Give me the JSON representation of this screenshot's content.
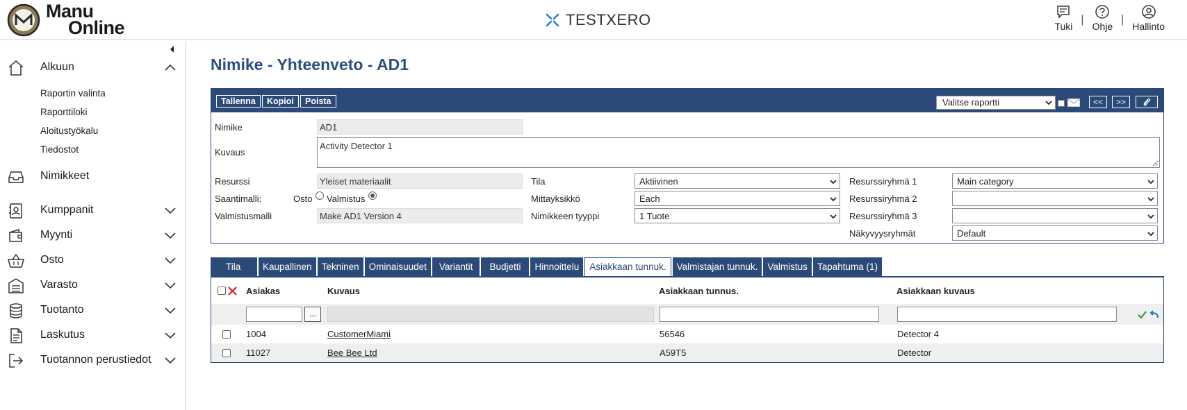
{
  "header": {
    "logo_line1": "Manu",
    "logo_line2": "Online",
    "brand": "TESTXERO",
    "actions": [
      {
        "label": "Tuki",
        "icon": "chat-icon"
      },
      {
        "label": "Ohje",
        "icon": "help-icon"
      },
      {
        "label": "Hallinto",
        "icon": "user-icon"
      }
    ],
    "separator": "|"
  },
  "sidebar": {
    "items": [
      {
        "label": "Alkuun",
        "icon": "home-icon",
        "expanded": true
      },
      {
        "label": "Nimikkeet",
        "icon": "inbox-icon"
      },
      {
        "label": "Kumppanit",
        "icon": "contacts-icon"
      },
      {
        "label": "Myynti",
        "icon": "wallet-icon"
      },
      {
        "label": "Osto",
        "icon": "basket-icon"
      },
      {
        "label": "Varasto",
        "icon": "warehouse-icon"
      },
      {
        "label": "Tuotanto",
        "icon": "database-icon"
      },
      {
        "label": "Laskutus",
        "icon": "invoice-icon"
      },
      {
        "label": "Tuotannon perustiedot",
        "icon": "exit-icon"
      }
    ],
    "sub_items": [
      "Raportin valinta",
      "Raporttiloki",
      "Aloitustyökalu",
      "Tiedostot"
    ]
  },
  "page": {
    "title": "Nimike - Yhteenveto - AD1"
  },
  "toolbar": {
    "buttons": [
      "Tallenna",
      "Kopioi",
      "Poista"
    ],
    "report_select": "Valitse raportti",
    "prev": "<<",
    "next": ">>"
  },
  "form": {
    "nimike_label": "Nimike",
    "nimike_value": "AD1",
    "kuvaus_label": "Kuvaus",
    "kuvaus_value": "Activity Detector 1",
    "resurssi_label": "Resurssi",
    "resurssi_value": "Yleiset materiaalit",
    "saantimalli_label": "Saantimalli:",
    "osto_label": "Osto",
    "valmistus_label": "Valmistus",
    "valmistusmalli_label": "Valmistusmalli",
    "valmistusmalli_value": "Make AD1 Version 4",
    "tila_label": "Tila",
    "tila_value": "Aktiivinen",
    "mittayksikko_label": "Mittayksikkö",
    "mittayksikko_value": "Each",
    "tyyppi_label": "Nimikkeen tyyppi",
    "tyyppi_value": "1 Tuote",
    "rr1_label": "Resurssiryhmä 1",
    "rr1_value": "Main category",
    "rr2_label": "Resurssiryhmä 2",
    "rr2_value": "",
    "rr3_label": "Resurssiryhmä 3",
    "rr3_value": "",
    "nakyvyys_label": "Näkyvyysryhmät",
    "nakyvyys_value": "Default"
  },
  "tabs": [
    {
      "label": "Tila"
    },
    {
      "label": "Kaupallinen"
    },
    {
      "label": "Tekninen"
    },
    {
      "label": "Ominaisuudet"
    },
    {
      "label": "Variantit"
    },
    {
      "label": "Budjetti"
    },
    {
      "label": "Hinnoittelu"
    },
    {
      "label": "Asiakkaan tunnuk.",
      "active": true
    },
    {
      "label": "Valmistajan tunnuk."
    },
    {
      "label": "Valmistus"
    },
    {
      "label": "Tapahtuma (1)"
    }
  ],
  "grid": {
    "columns": [
      "Asiakas",
      "Kuvaus",
      "Asiakkaan tunnus.",
      "Asiakkaan kuvaus"
    ],
    "dots": "...",
    "rows": [
      {
        "asiakas": "1004",
        "kuvaus": "CustomerMiami",
        "tunnus": "56546",
        "asiakkaan_kuvaus": "Detector 4"
      },
      {
        "asiakas": "11027",
        "kuvaus": "Bee Bee Ltd",
        "tunnus": "A59T5",
        "asiakkaan_kuvaus": "Detector"
      }
    ]
  },
  "colors": {
    "primary": "#2c4a78",
    "title": "#2c4f7c",
    "accept": "#2e9e3e",
    "undo": "#2a6fc1",
    "delete": "#cc1f1f"
  }
}
